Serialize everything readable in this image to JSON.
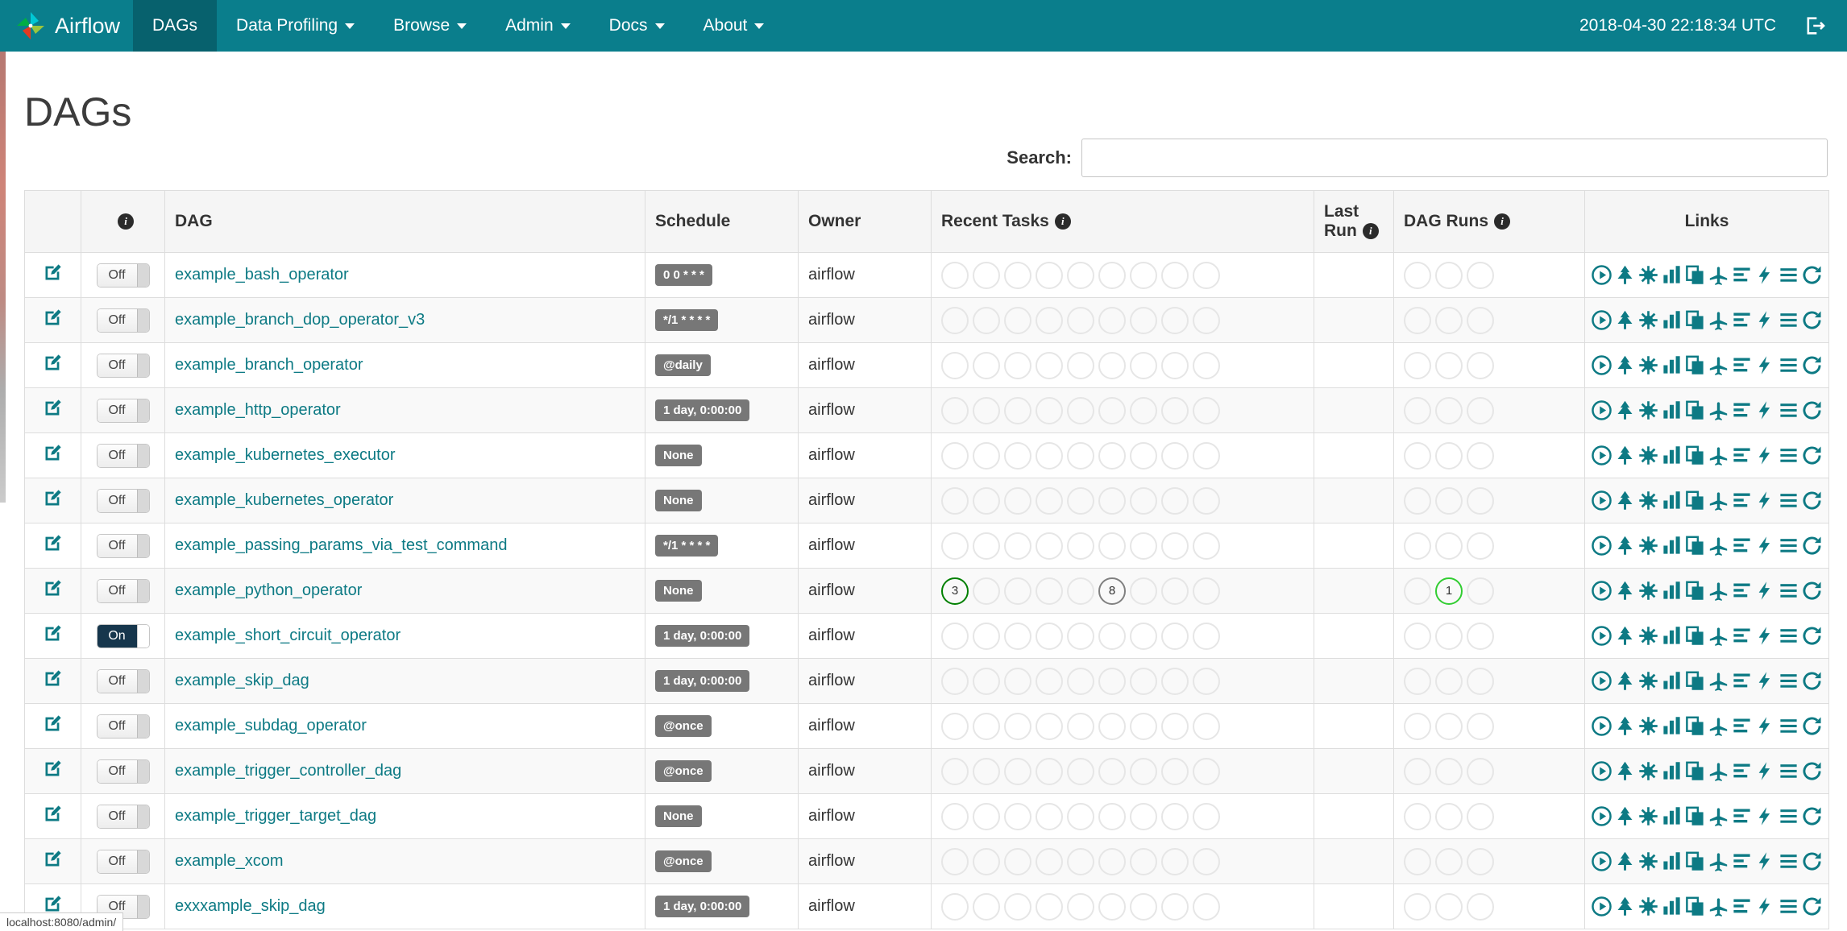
{
  "navbar": {
    "brand": "Airflow",
    "items": [
      {
        "label": "DAGs",
        "active": true,
        "caret": false
      },
      {
        "label": "Data Profiling",
        "active": false,
        "caret": true
      },
      {
        "label": "Browse",
        "active": false,
        "caret": true
      },
      {
        "label": "Admin",
        "active": false,
        "caret": true
      },
      {
        "label": "Docs",
        "active": false,
        "caret": true
      },
      {
        "label": "About",
        "active": false,
        "caret": true
      }
    ],
    "clock": "2018-04-30 22:18:34 UTC",
    "logout_icon": "sign-out-icon",
    "logo_icon": "airflow-pinwheel-icon"
  },
  "page": {
    "title": "DAGs",
    "search_label": "Search:",
    "search_value": "",
    "status_bar": "localhost:8080/admin/"
  },
  "colors": {
    "navbar_bg": "#0A7E8C",
    "navbar_active_bg": "#07616D",
    "link_teal": "#0D7A84",
    "badge_bg": "#777777",
    "success_green": "#008000",
    "running_green": "#32CD32",
    "queued_gray": "#808080",
    "toggle_on_bg": "#16364C"
  },
  "table": {
    "columns": [
      {
        "name": "edit",
        "label": "",
        "info": false
      },
      {
        "name": "toggle",
        "label": "",
        "info": true
      },
      {
        "name": "dag",
        "label": "DAG",
        "info": false
      },
      {
        "name": "schedule",
        "label": "Schedule",
        "info": false
      },
      {
        "name": "owner",
        "label": "Owner",
        "info": false
      },
      {
        "name": "recent",
        "label": "Recent Tasks",
        "info": true
      },
      {
        "name": "lastrun",
        "label": "Last Run",
        "info": true
      },
      {
        "name": "dagruns",
        "label": "DAG Runs",
        "info": true
      },
      {
        "name": "links",
        "label": "Links",
        "info": false
      }
    ],
    "toggle_on_label": "On",
    "toggle_off_label": "Off",
    "recent_slots": 9,
    "dagrun_slots": 3,
    "link_icons": [
      "trigger-dag-icon",
      "tree-view-icon",
      "graph-view-icon",
      "task-duration-icon",
      "task-tries-icon",
      "landing-times-icon",
      "gantt-view-icon",
      "code-view-icon",
      "log-icon",
      "refresh-icon"
    ],
    "rows": [
      {
        "dag": "example_bash_operator",
        "schedule": "0 0 * * *",
        "owner": "airflow",
        "on": false,
        "recent": [],
        "dag_runs": []
      },
      {
        "dag": "example_branch_dop_operator_v3",
        "schedule": "*/1 * * * *",
        "owner": "airflow",
        "on": false,
        "recent": [],
        "dag_runs": []
      },
      {
        "dag": "example_branch_operator",
        "schedule": "@daily",
        "owner": "airflow",
        "on": false,
        "recent": [],
        "dag_runs": []
      },
      {
        "dag": "example_http_operator",
        "schedule": "1 day, 0:00:00",
        "owner": "airflow",
        "on": false,
        "recent": [],
        "dag_runs": []
      },
      {
        "dag": "example_kubernetes_executor",
        "schedule": "None",
        "owner": "airflow",
        "on": false,
        "recent": [],
        "dag_runs": []
      },
      {
        "dag": "example_kubernetes_operator",
        "schedule": "None",
        "owner": "airflow",
        "on": false,
        "recent": [],
        "dag_runs": []
      },
      {
        "dag": "example_passing_params_via_test_command",
        "schedule": "*/1 * * * *",
        "owner": "airflow",
        "on": false,
        "recent": [],
        "dag_runs": []
      },
      {
        "dag": "example_python_operator",
        "schedule": "None",
        "owner": "airflow",
        "on": false,
        "recent": [
          {
            "slot": 0,
            "count": "3",
            "color": "#008000"
          },
          {
            "slot": 5,
            "count": "8",
            "color": "#808080"
          }
        ],
        "dag_runs": [
          {
            "slot": 1,
            "count": "1",
            "color": "#32CD32"
          }
        ]
      },
      {
        "dag": "example_short_circuit_operator",
        "schedule": "1 day, 0:00:00",
        "owner": "airflow",
        "on": true,
        "recent": [],
        "dag_runs": []
      },
      {
        "dag": "example_skip_dag",
        "schedule": "1 day, 0:00:00",
        "owner": "airflow",
        "on": false,
        "recent": [],
        "dag_runs": []
      },
      {
        "dag": "example_subdag_operator",
        "schedule": "@once",
        "owner": "airflow",
        "on": false,
        "recent": [],
        "dag_runs": []
      },
      {
        "dag": "example_trigger_controller_dag",
        "schedule": "@once",
        "owner": "airflow",
        "on": false,
        "recent": [],
        "dag_runs": []
      },
      {
        "dag": "example_trigger_target_dag",
        "schedule": "None",
        "owner": "airflow",
        "on": false,
        "recent": [],
        "dag_runs": []
      },
      {
        "dag": "example_xcom",
        "schedule": "@once",
        "owner": "airflow",
        "on": false,
        "recent": [],
        "dag_runs": []
      },
      {
        "dag": "exxxample_skip_dag",
        "schedule": "1 day, 0:00:00",
        "owner": "airflow",
        "on": false,
        "recent": [],
        "dag_runs": []
      }
    ]
  }
}
